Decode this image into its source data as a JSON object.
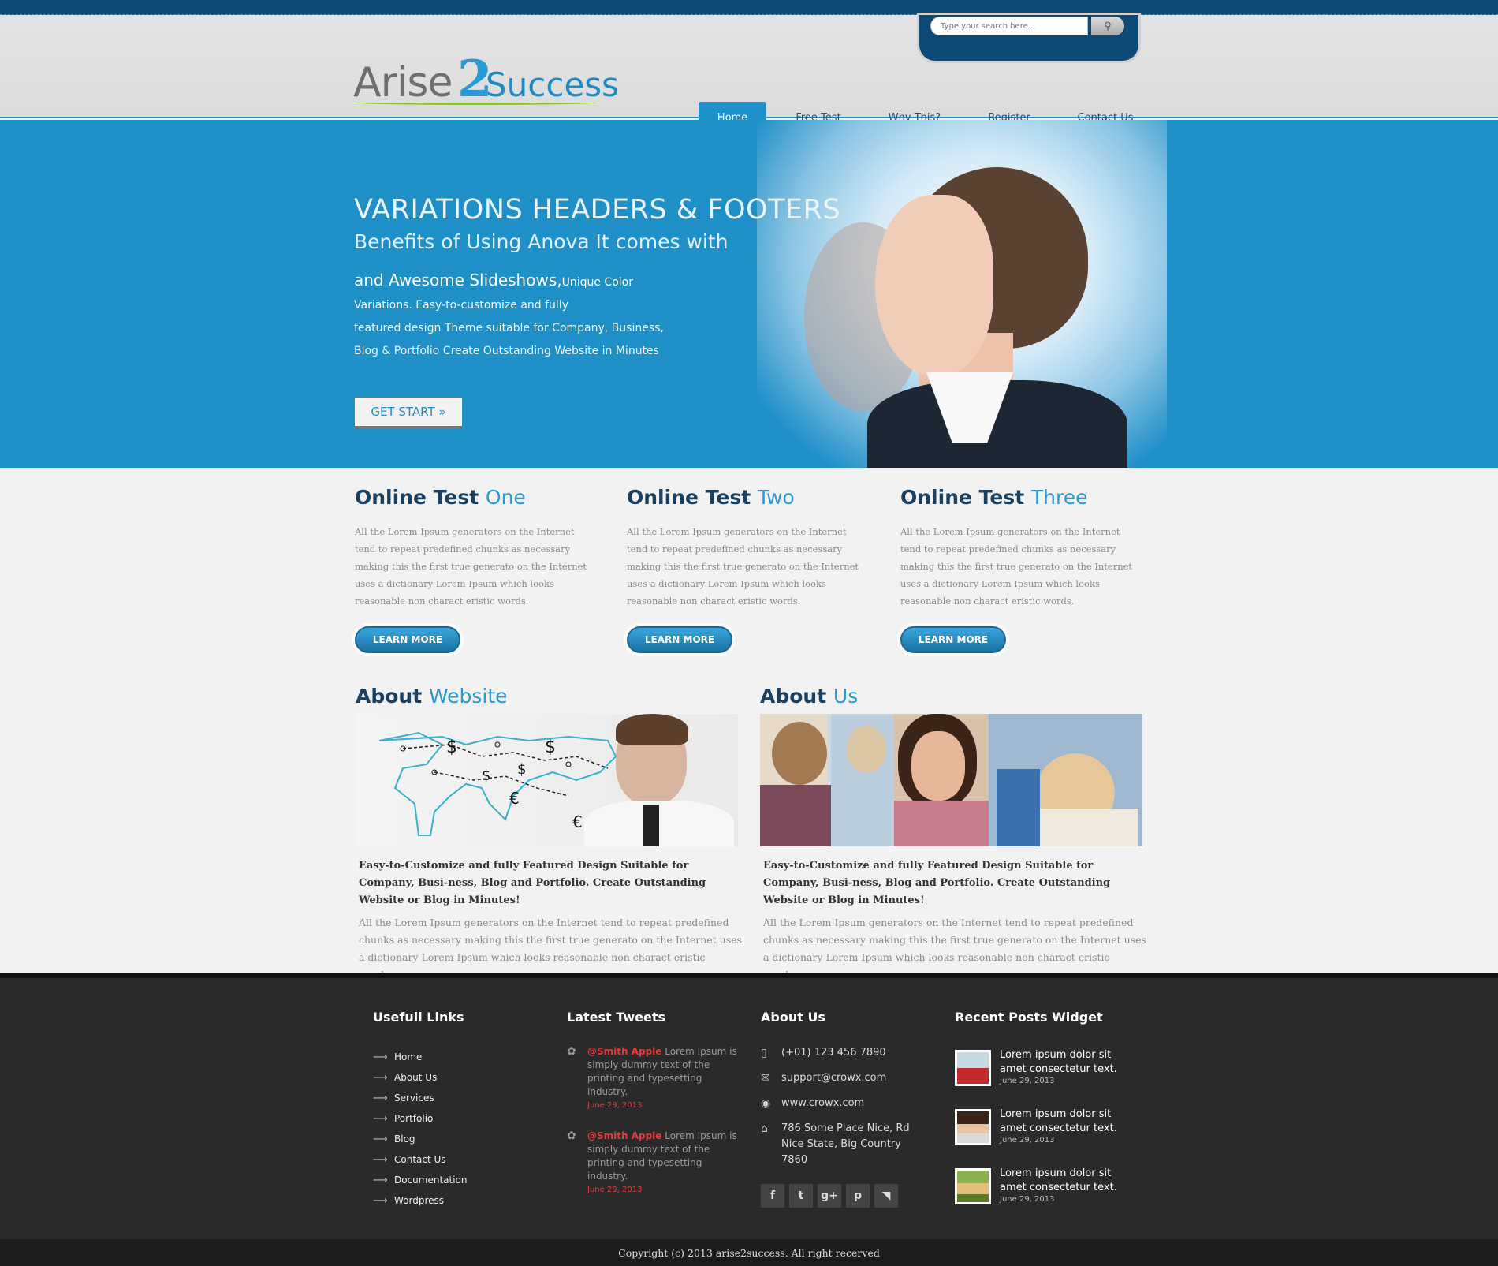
{
  "search": {
    "placeholder": "Type your search here...",
    "button_icon": "magnifier-icon"
  },
  "logo": {
    "part1": "Arise",
    "part2": "2",
    "part3": "Success"
  },
  "nav": [
    {
      "label": "Home",
      "active": true
    },
    {
      "label": "Free Test",
      "active": false
    },
    {
      "label": "Why This?",
      "active": false
    },
    {
      "label": "Register",
      "active": false
    },
    {
      "label": "Contact Us",
      "active": false
    }
  ],
  "hero": {
    "title": "VARIATIONS HEADERS & FOOTERS",
    "subtitle": "Benefits of Using Anova It comes with",
    "lead_big": "and Awesome Slideshows,",
    "lead_small": "Unique Color",
    "lines": [
      "Variations. Easy-to-customize and fully",
      "featured design Theme suitable for Company, Business,",
      "Blog & Portfolio Create Outstanding Website in Minutes"
    ],
    "cta": "GET START »"
  },
  "online_tests": [
    {
      "title": "Online Test",
      "highlight": "One",
      "body": "All the Lorem Ipsum generators on the Internet tend to repeat predefined chunks as necessary making this the first true generato on the Internet uses a dictionary Lorem Ipsum which looks reasonable non charact eristic words.",
      "button": "LEARN MORE"
    },
    {
      "title": "Online Test",
      "highlight": "Two",
      "body": "All the Lorem Ipsum generators on the Internet tend to repeat predefined chunks as necessary making this the first true generato on the Internet uses a dictionary Lorem Ipsum which looks reasonable non charact eristic words.",
      "button": "LEARN MORE"
    },
    {
      "title": "Online Test",
      "highlight": "Three",
      "body": "All the Lorem Ipsum generators on the Internet tend to repeat predefined chunks as necessary making this the first true generato on the Internet uses a dictionary Lorem Ipsum which looks reasonable non charact eristic words.",
      "button": "LEARN MORE"
    }
  ],
  "about": [
    {
      "title": "About",
      "highlight": "Website",
      "caption": "Easy-to-Customize and fully Featured Design Suitable for Company, Busi-ness, Blog and Portfolio. Create Outstanding Website or Blog in Minutes!",
      "body": "All the Lorem Ipsum generators on the Internet tend to repeat predefined chunks as necessary making this the first true generato on the Internet uses a dictionary Lorem Ipsum which looks reasonable non charact eristic words."
    },
    {
      "title": "About",
      "highlight": "Us",
      "caption": "Easy-to-Customize and fully Featured Design Suitable for Company, Busi-ness, Blog and Portfolio. Create Outstanding Website or Blog in Minutes!",
      "body": "All the Lorem Ipsum generators on the Internet tend to repeat predefined chunks as necessary making this the first true generato on the Internet uses a dictionary Lorem Ipsum which looks reasonable non charact eristic words."
    }
  ],
  "footer": {
    "links_title": "Usefull Links",
    "links": [
      "Home",
      "About Us",
      "Services",
      "Portfolio",
      "Blog",
      "Contact Us",
      "Documentation",
      "Wordpress"
    ],
    "tweets_title": "Latest Tweets",
    "tweets": [
      {
        "user": "@Smith Apple",
        "text": " Lorem Ipsum is simply dummy text of the printing and typesetting industry.",
        "date": "June 29, 2013"
      },
      {
        "user": "@Smith Apple",
        "text": " Lorem Ipsum is simply dummy text of the printing and typesetting industry.",
        "date": "June 29, 2013"
      }
    ],
    "about_title": "About Us",
    "phone": "(+01) 123 456 7890",
    "email": "support@crowx.com",
    "web": "www.crowx.com",
    "address": "786 Some Place Nice, Rd Nice State, Big Country 7860",
    "social": [
      {
        "icon": "facebook-icon",
        "glyph": "f"
      },
      {
        "icon": "twitter-icon",
        "glyph": "t"
      },
      {
        "icon": "google-plus-icon",
        "glyph": "g+"
      },
      {
        "icon": "pinterest-icon",
        "glyph": "p"
      },
      {
        "icon": "rss-icon",
        "glyph": "◥"
      }
    ],
    "posts_title": "Recent Posts Widget",
    "posts": [
      {
        "title": "Lorem ipsum dolor sit amet consectetur text.",
        "date": "June 29, 2013"
      },
      {
        "title": "Lorem ipsum dolor sit amet consectetur text.",
        "date": "June 29, 2013"
      },
      {
        "title": "Lorem ipsum dolor sit amet consectetur text.",
        "date": "June 29, 2013"
      }
    ]
  },
  "copyright": "Copyright (c) 2013 arise2success. All right recerved",
  "colors": {
    "primary_blue": "#1f8fc8",
    "dark_navy": "#0e4976",
    "footer_bg": "#2a2a2a",
    "tweet_red": "#e23b3b"
  }
}
